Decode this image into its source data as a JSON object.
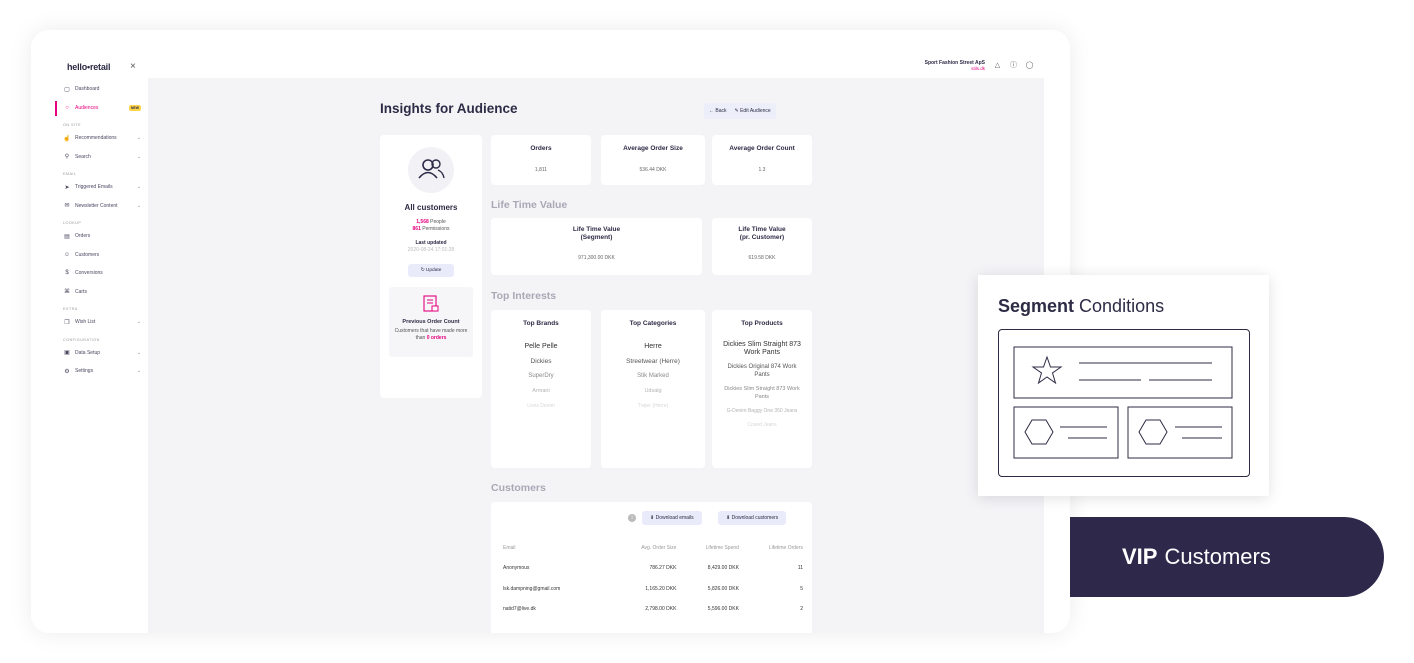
{
  "app": {
    "logo": "hello•retail",
    "close": "×"
  },
  "sidebar": {
    "items": [
      {
        "label": "Dashboard",
        "icon": "monitor-icon",
        "glyph": "▢"
      },
      {
        "label": "Audiences",
        "icon": "audience-icon",
        "glyph": "○",
        "badge": "NEW"
      },
      {
        "section": "ON SITE"
      },
      {
        "label": "Recommendations",
        "icon": "thumbs-up-icon",
        "glyph": "☝"
      },
      {
        "label": "Search",
        "icon": "search-icon",
        "glyph": "⚲"
      },
      {
        "section": "EMAIL"
      },
      {
        "label": "Triggered Emails",
        "icon": "send-icon",
        "glyph": "➤"
      },
      {
        "label": "Newsletter Content",
        "icon": "mail-icon",
        "glyph": "✉"
      },
      {
        "section": "LOOKUP"
      },
      {
        "label": "Orders",
        "icon": "orders-icon",
        "glyph": "▤"
      },
      {
        "label": "Customers",
        "icon": "users-icon",
        "glyph": "☺"
      },
      {
        "label": "Conversions",
        "icon": "dollar-icon",
        "glyph": "$"
      },
      {
        "label": "Carts",
        "icon": "cart-icon",
        "glyph": "⌘"
      },
      {
        "section": "EXTRA"
      },
      {
        "label": "Wish List",
        "icon": "gift-icon",
        "glyph": "❐"
      },
      {
        "section": "CONFIGURATION"
      },
      {
        "label": "Data Setup",
        "icon": "database-icon",
        "glyph": "▣"
      },
      {
        "label": "Settings",
        "icon": "gear-icon",
        "glyph": "⚙"
      }
    ]
  },
  "topbar": {
    "company": "Sport Fashion Street ApS",
    "domain": "stils.dk"
  },
  "page": {
    "title": "Insights for Audience",
    "back": "← Back",
    "edit": "✎ Edit Audience"
  },
  "left_card": {
    "title": "All customers",
    "people_count": "1,568",
    "people_label": " People",
    "perm_count": "861",
    "perm_label": " Permissions",
    "last_updated_label": "Last updated",
    "last_updated_value": "2020-08-24 17:01:28",
    "update_button": "↻ Update",
    "prev_title": "Previous Order Count",
    "prev_desc": "Customers that have made more than ",
    "prev_orders": "0 orders"
  },
  "stats": [
    {
      "title": "Orders",
      "value": "1,811"
    },
    {
      "title": "Average Order Size",
      "value": "536.44 DKK"
    },
    {
      "title": "Average Order Count",
      "value": "1.3"
    }
  ],
  "ltv": {
    "heading": "Life Time Value",
    "segment_title": "Life Time Value\n(Segment)",
    "segment_value": "971,300.00 DKK",
    "customer_title": "Life Time Value\n(pr. Customer)",
    "customer_value": "619.58 DKK"
  },
  "interests": {
    "heading": "Top Interests",
    "brands": {
      "title": "Top Brands",
      "items": [
        "Pelle Pelle",
        "Dickies",
        "SuperDry",
        "Armani",
        "Levis Denim"
      ]
    },
    "categories": {
      "title": "Top Categories",
      "items": [
        "Herre",
        "Streetwear (Herre)",
        "Stik Marked",
        "Udsalg",
        "Trøjer (Herre)"
      ]
    },
    "products": {
      "title": "Top Products",
      "items": [
        "Dickies Slim Straight 873 Work Pants",
        "Dickies Original 874 Work Pants",
        "Dickies Slim Straight 873 Work Pants",
        "G-Denim Baggy One 350 Jeans",
        "Cosed Jeans"
      ]
    }
  },
  "customers": {
    "heading": "Customers",
    "info": "i",
    "download_emails": "⬇ Download emails",
    "download_customers": "⬇ Download customers",
    "columns": [
      "Email",
      "Avg. Order Size",
      "Lifetime Spend",
      "Lifetime Orders"
    ],
    "rows": [
      [
        "Anonymous",
        "786.27 DKK",
        "8,429.00 DKK",
        "11"
      ],
      [
        "lsk.dampning@gmail.com",
        "1,165.20 DKK",
        "5,826.00 DKK",
        "5"
      ],
      [
        "natid7@live.dk",
        "2,798.00 DKK",
        "5,596.00 DKK",
        "2"
      ]
    ]
  },
  "segment": {
    "bold": "Segment",
    "rest": " Conditions"
  },
  "vip": {
    "bold": "VIP",
    "rest": "Customers"
  }
}
